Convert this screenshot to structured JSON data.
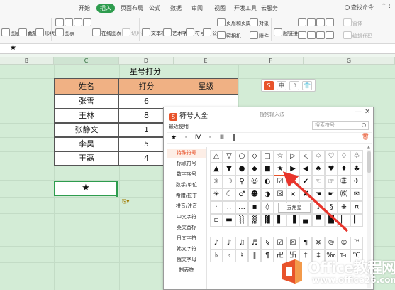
{
  "ribbon": {
    "tabs": [
      "开始",
      "插入",
      "页面布局",
      "公式",
      "数据",
      "审阅",
      "视图",
      "开发工具",
      "云服务"
    ],
    "active_tab": "插入",
    "search": "查找命令",
    "items": [
      {
        "name": "pivot-table-button",
        "label": "图表"
      },
      {
        "name": "screenshot-button",
        "label": "截屏"
      },
      {
        "name": "shapes-button",
        "label": "形状"
      },
      {
        "name": "chart-button",
        "label": "图表"
      },
      {
        "name": "online-chart-button",
        "label": "在线图表"
      },
      {
        "name": "slicer-button",
        "label": "切片器"
      },
      {
        "name": "textbox-button",
        "label": "文本框"
      },
      {
        "name": "wordart-button",
        "label": "艺术字"
      },
      {
        "name": "symbol-button",
        "label": "符号"
      },
      {
        "name": "formula-button",
        "label": "公式"
      },
      {
        "name": "header-footer-button",
        "label": "页眉和页脚"
      },
      {
        "name": "object-button",
        "label": "对象"
      },
      {
        "name": "camera-button",
        "label": "照相机"
      },
      {
        "name": "attachment-button",
        "label": "附件"
      },
      {
        "name": "hyperlink-button",
        "label": "超链接"
      },
      {
        "name": "form-button",
        "label": "窗体"
      },
      {
        "name": "editor-button",
        "label": "编辑代码"
      }
    ]
  },
  "formula_bar": {
    "value": "★"
  },
  "columns": [
    "B",
    "C",
    "D",
    "E",
    "F",
    "G"
  ],
  "table": {
    "title": "星号打分",
    "headers": [
      "姓名",
      "打分",
      "星级"
    ],
    "rows": [
      {
        "name": "张雪",
        "score": "6"
      },
      {
        "name": "王林",
        "score": "8"
      },
      {
        "name": "张静文",
        "score": "1"
      },
      {
        "name": "李昊",
        "score": "5"
      },
      {
        "name": "王磊",
        "score": "4"
      }
    ]
  },
  "active_cell": {
    "value": "★"
  },
  "float_toolbar": {
    "buttons": [
      "S",
      "中",
      "☽",
      "👕"
    ]
  },
  "dialog": {
    "title": "符号大全",
    "subtitle": "搜狗输入法",
    "minimize": "—",
    "close": "✕",
    "recent_label": "最近使用",
    "search_placeholder": "搜索符号",
    "recent_symbols": [
      "★",
      "·",
      "Ⅳ",
      "·",
      "Ⅲ",
      "‖"
    ],
    "categories": [
      "特殊符号",
      "标点符号",
      "数字序号",
      "数学/单位",
      "希腊/拉丁",
      "拼音/注音",
      "中文字符",
      "英文音标",
      "日文字符",
      "韩文字符",
      "俄文字母",
      "制表符"
    ],
    "active_category": "特殊符号",
    "symbols_top": [
      "△",
      "▽",
      "○",
      "◇",
      "□",
      "☆",
      "▷",
      "◁",
      "♤",
      "♡",
      "♢",
      "♧",
      "▲",
      "▼",
      "●",
      "◆",
      "■",
      "★",
      "▶",
      "◀",
      "♠",
      "♥",
      "♦",
      "♣",
      "☼",
      "☽",
      "♀",
      "☺",
      "◐",
      "☑",
      "√",
      "✔",
      "☜",
      "☞",
      "㊣",
      "✈",
      "☀",
      "☾",
      "♂",
      "☻",
      "◑",
      "☒",
      "×",
      "✘",
      "☚",
      "☛",
      "㈱",
      "✉",
      "·",
      "‥",
      "…",
      "▪",
      "◊",
      "♪",
      "♫",
      "♬",
      "♩",
      "§",
      "※",
      "¤",
      "▫",
      "▬",
      "░",
      "▒",
      "▓",
      "▌",
      "▐",
      "▄",
      "▀",
      "█",
      "▏",
      "▎"
    ],
    "symbols_bottom": [
      "♪",
      "♪",
      "♫",
      "♬",
      "§",
      "☑",
      "☒",
      "¶",
      "※",
      "®",
      "©",
      "™",
      "♭",
      "♭",
      "♮",
      "‖",
      "¶",
      "卍",
      "卐",
      "†",
      "‡",
      "‰",
      "℡",
      "℃"
    ],
    "tooltip": "五角星"
  },
  "watermark": {
    "main": "Office教程网",
    "sub": "www.office26.com"
  },
  "colors": {
    "brand_green": "#2e9c4e",
    "table_header": "#f0b184",
    "sogou_orange": "#e8532b",
    "arrow_red": "#e8342b",
    "sheet_bg": "#d3ecd6"
  }
}
